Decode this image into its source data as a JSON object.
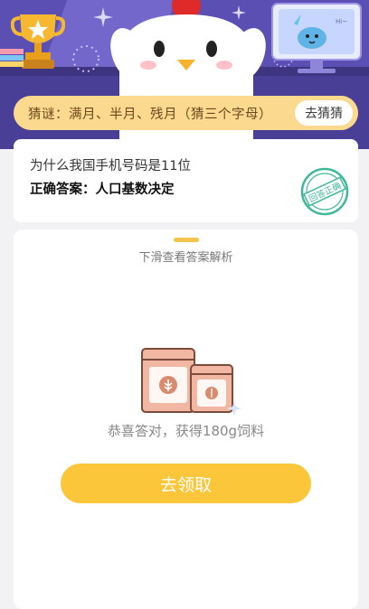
{
  "riddle": {
    "text": "猜谜：满月、半月、残月（猜三个字母）",
    "button_label": "去猜猜"
  },
  "qa": {
    "question": "为什么我国手机号码是11位",
    "answer_prefix": "正确答案：",
    "answer_value": "人口基数决定",
    "stamp_text": "回答正确"
  },
  "reward": {
    "swipe_hint": "下滑查看答案解析",
    "congrats": "恭喜答对，获得180g饲料",
    "claim_label": "去领取"
  },
  "colors": {
    "accent": "#fcc63a",
    "riddle_bg": "#fbd98e",
    "hero_bg": "#5b4fb3",
    "stamp": "#3fb89a"
  },
  "icons": {
    "hero_left": "trophy-icon",
    "hero_center": "chicken-mascot",
    "hero_right": "monitor-mascot-icon",
    "reward": "feed-bags-icon"
  }
}
